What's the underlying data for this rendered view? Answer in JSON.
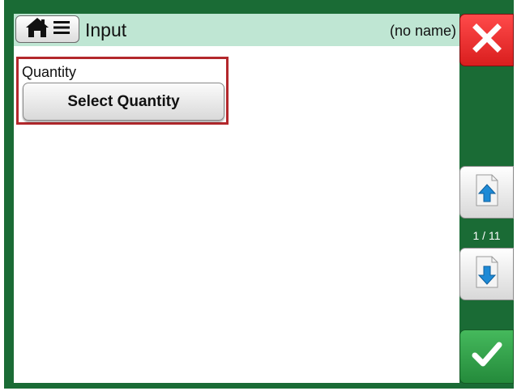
{
  "header": {
    "title": "Input",
    "document_name": "(no name)"
  },
  "icons": {
    "home": "home-icon",
    "menu": "menu-icon",
    "close": "close-icon",
    "page_up": "page-up-icon",
    "page_down": "page-down-icon",
    "ok": "checkmark-icon"
  },
  "form": {
    "quantity_label": "Quantity",
    "select_quantity_button": "Select Quantity"
  },
  "pager": {
    "indicator": "1 / 11"
  },
  "colors": {
    "frame": "#1a6b35",
    "titlebar": "#bfe6d3",
    "highlight": "#b3282c",
    "close": "#e02424",
    "ok": "#2e9e46",
    "arrow": "#1e8ad6"
  }
}
